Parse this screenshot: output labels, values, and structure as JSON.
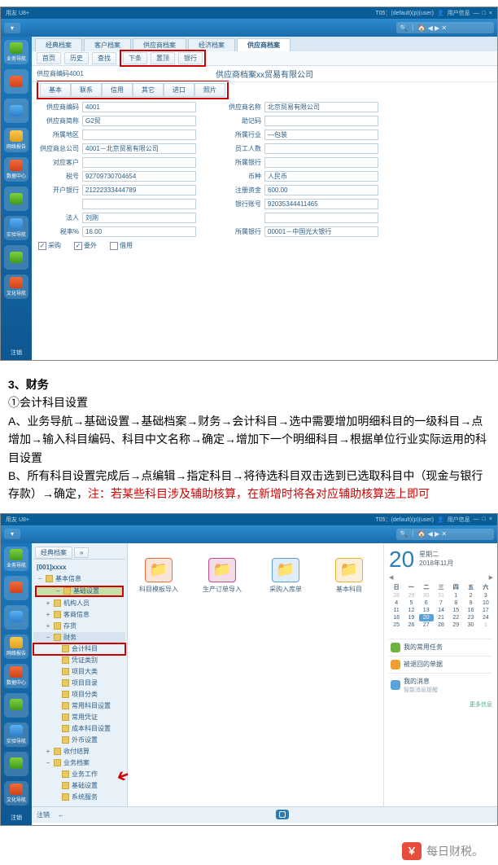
{
  "app": {
    "title_left": "用友 U8+",
    "title_right": "T05：(default)(p)(user)",
    "user_menu": "用户信息",
    "tabs": [
      "经典档案",
      "客户档案",
      "供应商档案",
      "经济档案",
      "供应商档案"
    ],
    "subtoolbar": {
      "nav": [
        "首页",
        "历史",
        "查找"
      ],
      "red": [
        "下条",
        "置顶",
        "银行"
      ]
    }
  },
  "sidebar1": [
    {
      "cls": "g",
      "label": "业务导航"
    },
    {
      "cls": "r",
      "label": ""
    },
    {
      "cls": "b",
      "label": ""
    },
    {
      "cls": "y",
      "label": "网络报告"
    },
    {
      "cls": "r",
      "label": "数据中心"
    },
    {
      "cls": "g",
      "label": ""
    },
    {
      "cls": "b",
      "label": "实验导航"
    },
    {
      "cls": "g",
      "label": ""
    },
    {
      "cls": "r",
      "label": "文化导航"
    }
  ],
  "form": {
    "title_left": "供应商编码4001",
    "title": "供应商档案xx贸易有限公司",
    "inner_tabs": [
      "基本",
      "联系",
      "信用",
      "其它",
      "进口",
      "照片"
    ],
    "rows": [
      {
        "l": "供应商编码",
        "v": "4001",
        "l2": "供应商名称",
        "v2": "北京贸易有限公司"
      },
      {
        "l": "供应商简称",
        "v": "G2贸",
        "l2": "助记码",
        "v2": ""
      },
      {
        "l": "所属地区",
        "v": "",
        "l2": "所属行业",
        "v2": "—包装"
      },
      {
        "l": "供应商总公司",
        "v": "4001－北京贸易有限公司",
        "l2": "员工人数",
        "v2": ""
      },
      {
        "l": "对应客户",
        "v": "",
        "l2": "所属银行",
        "v2": ""
      },
      {
        "l": "税号",
        "v": "92709730704654",
        "l2": "币种",
        "v2": "人民币"
      },
      {
        "l": "开户银行",
        "v": "21222333444789",
        "l2": "注册资金",
        "v2": "600.00"
      },
      {
        "l": "",
        "v": "",
        "l2": "银行账号",
        "v2": "92035344411465"
      },
      {
        "l": "法人",
        "v": "刘刚",
        "l2": "",
        "v2": ""
      },
      {
        "l": "税率%",
        "v": "16.00",
        "l2": "所属银行",
        "v2": "00001－中国光大银行"
      }
    ],
    "checks": [
      {
        "label": "采购",
        "checked": true
      },
      {
        "label": "委外",
        "checked": true
      },
      {
        "label": "借用",
        "checked": false
      }
    ]
  },
  "doc": {
    "h": "3、财务",
    "sub": "①会计科目设置",
    "pA": "A、业务导航→基础设置→基础档案→财务→会计科目→选中需要增加明细科目的一级科目→点增加→输入科目编码、科目中文名称→确定→增加下一个明细科目→根据单位行业实际运用的科目设置",
    "pB1": "B、所有科目设置完成后→点编辑→指定科目→将待选科目双击选到已选取科目中（现金与银行存款）→确定，",
    "pB2": "注：若某些科目涉及辅助核算，在新增时将各对应辅助核算选上即可"
  },
  "tree": {
    "top": [
      "经典档案",
      "»"
    ],
    "title": "[001]xxxx",
    "nodes": [
      {
        "d": 0,
        "exp": "−",
        "t": "基本信息"
      },
      {
        "d": 0,
        "exp": "−",
        "t": "基础设置",
        "hl": true
      },
      {
        "d": 1,
        "exp": "+",
        "t": "机构人员"
      },
      {
        "d": 1,
        "exp": "+",
        "t": "客商信息"
      },
      {
        "d": 1,
        "exp": "+",
        "t": "存货"
      },
      {
        "d": 1,
        "exp": "−",
        "t": "财务",
        "hl2": true
      },
      {
        "d": 2,
        "exp": "",
        "t": "会计科目",
        "red_inline": true
      },
      {
        "d": 2,
        "exp": "",
        "t": "凭证类别"
      },
      {
        "d": 2,
        "exp": "",
        "t": "项目大类"
      },
      {
        "d": 2,
        "exp": "",
        "t": "项目目录"
      },
      {
        "d": 2,
        "exp": "",
        "t": "项目分类"
      },
      {
        "d": 2,
        "exp": "",
        "t": "常用科目设置"
      },
      {
        "d": 2,
        "exp": "",
        "t": "常用凭证"
      },
      {
        "d": 2,
        "exp": "",
        "t": "成本科目设置"
      },
      {
        "d": 2,
        "exp": "",
        "t": "外币设置"
      },
      {
        "d": 1,
        "exp": "+",
        "t": "收付结算"
      },
      {
        "d": 1,
        "exp": "−",
        "t": "业务档案"
      },
      {
        "d": 2,
        "exp": "",
        "t": "业务工作"
      },
      {
        "d": 2,
        "exp": "",
        "t": "基础设置",
        "arrow": true
      },
      {
        "d": 2,
        "exp": "",
        "t": "系统服务"
      }
    ]
  },
  "desktop_icons": [
    {
      "t": "科目模板导入",
      "c": "#e7733f"
    },
    {
      "t": "生产订单导入",
      "c": "#c74a8b"
    },
    {
      "t": "采购入库单",
      "c": "#5aa3d8"
    },
    {
      "t": "基本科目",
      "c": "#e8b23a"
    }
  ],
  "calendar": {
    "daynum": "20",
    "weekday": "星期二",
    "yearmonth": "2018年11月",
    "dow": [
      "日",
      "一",
      "二",
      "三",
      "四",
      "五",
      "六"
    ],
    "cells": [
      {
        "t": "28",
        "m": 1
      },
      {
        "t": "29",
        "m": 1
      },
      {
        "t": "30",
        "m": 1
      },
      {
        "t": "31",
        "m": 1
      },
      {
        "t": "1"
      },
      {
        "t": "2"
      },
      {
        "t": "3"
      },
      {
        "t": "4"
      },
      {
        "t": "5"
      },
      {
        "t": "6"
      },
      {
        "t": "7"
      },
      {
        "t": "8"
      },
      {
        "t": "9"
      },
      {
        "t": "10"
      },
      {
        "t": "11"
      },
      {
        "t": "12"
      },
      {
        "t": "13"
      },
      {
        "t": "14"
      },
      {
        "t": "15"
      },
      {
        "t": "16"
      },
      {
        "t": "17"
      },
      {
        "t": "18"
      },
      {
        "t": "19"
      },
      {
        "t": "20",
        "today": 1
      },
      {
        "t": "21"
      },
      {
        "t": "22"
      },
      {
        "t": "23"
      },
      {
        "t": "24"
      },
      {
        "t": "25"
      },
      {
        "t": "26"
      },
      {
        "t": "27"
      },
      {
        "t": "28"
      },
      {
        "t": "29"
      },
      {
        "t": "30"
      },
      {
        "t": "1",
        "m": 1
      }
    ]
  },
  "todos": [
    {
      "c": "#6bb53f",
      "t": "我的常用任务"
    },
    {
      "c": "#f0a030",
      "t": "被退回的单据"
    },
    {
      "c": "#5aa3d8",
      "t": "我的消息",
      "s": "智能消息提醒"
    }
  ],
  "todo_more": "更多信息",
  "footer2": {
    "zhuxiao": "注销"
  },
  "watermark": "每日财税。"
}
